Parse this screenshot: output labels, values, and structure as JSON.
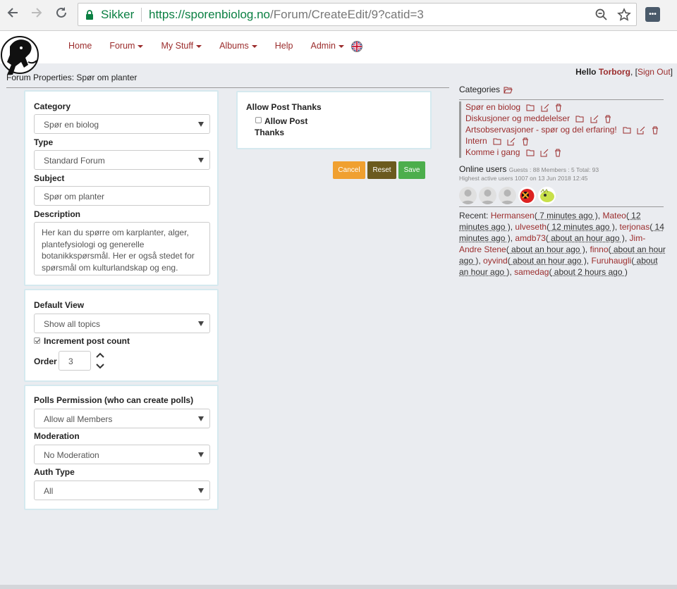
{
  "browser": {
    "secure_label": "Sikker",
    "url_host": "https://sporenbiolog.no",
    "url_path": "/Forum/CreateEdit/9?catid=3"
  },
  "nav": {
    "home": "Home",
    "forum": "Forum",
    "my_stuff": "My Stuff",
    "albums": "Albums",
    "help": "Help",
    "admin": "Admin"
  },
  "header": {
    "hello": "Hello",
    "user": "Torborg",
    "open_bracket": ", [",
    "sign_out": "Sign Out",
    "close_bracket": "]"
  },
  "page_title": "Forum Properties: Spør om planter",
  "form": {
    "category_label": "Category",
    "category_value": "Spør en biolog",
    "type_label": "Type",
    "type_value": "Standard Forum",
    "subject_label": "Subject",
    "subject_value": "Spør om planter",
    "description_label": "Description",
    "description_value": "Her kan du spørre om karplanter, alger, plantefysiologi og generelle botanikkspørsmål. Her er også stedet for spørsmål om kulturlandskap og eng.",
    "default_view_label": "Default View",
    "default_view_value": "Show all topics",
    "increment_label": "Increment post count",
    "order_label": "Order",
    "order_value": "3",
    "polls_label": "Polls Permission (who can create polls)",
    "polls_value": "Allow all Members",
    "moderation_label": "Moderation",
    "moderation_value": "No Moderation",
    "auth_label": "Auth Type",
    "auth_value": "All",
    "thanks_heading": "Allow Post Thanks",
    "thanks_checkbox_line1": "Allow Post",
    "thanks_checkbox_line2": "Thanks"
  },
  "buttons": {
    "cancel": "Cancel",
    "reset": "Reset",
    "save": "Save"
  },
  "sidebar": {
    "categories_label": "Categories",
    "categories": [
      "Spør en biolog",
      "Diskusjoner og meddelelser",
      "Artsobservasjoner - spør og del erfaring!",
      "Intern",
      "Komme i gang"
    ],
    "online_label": "Online users",
    "online_stats": "Guests : 88 Members : 5 Total: 93",
    "highest": "Highest active users 1007 on 13 Jun 2018 12:45",
    "recent_label": "Recent:",
    "recent": [
      {
        "user": "Hermansen",
        "time": " 7 minutes ago "
      },
      {
        "user": "Mateo",
        "time": " 12 minutes ago "
      },
      {
        "user": "ulveseth",
        "time": " 12 minutes ago "
      },
      {
        "user": "terjonas",
        "time": " 14 minutes ago "
      },
      {
        "user": "amdb73",
        "time": " about an hour ago "
      },
      {
        "user": "Jim-Andre Stene",
        "time": " about an hour ago "
      },
      {
        "user": "finno",
        "time": " about an hour ago "
      },
      {
        "user": "oyvind",
        "time": " about an hour ago "
      },
      {
        "user": "Furuhaugli",
        "time": " about an hour ago "
      },
      {
        "user": "samedag",
        "time": " about 2 hours ago "
      }
    ]
  },
  "colors": {
    "link": "#9b2c2c",
    "cancel": "#f0a030",
    "reset": "#6b5a1e",
    "save": "#4cae4c"
  }
}
